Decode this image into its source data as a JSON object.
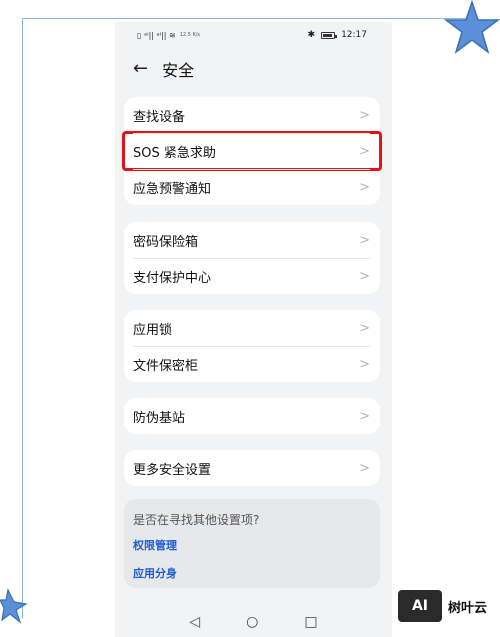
{
  "status_bar": {
    "left_signal": "▯ ᵃᴵ|| ᵃᴵ|| ≋",
    "left_speed": "12.5 K/s",
    "time": "12:17"
  },
  "header": {
    "back_symbol": "←",
    "title": "安全"
  },
  "groups": [
    {
      "items": [
        {
          "label": "查找设备",
          "highlighted": false
        },
        {
          "label": "SOS 紧急求助",
          "highlighted": true
        },
        {
          "label": "应急预警通知",
          "highlighted": false
        }
      ]
    },
    {
      "items": [
        {
          "label": "密码保险箱"
        },
        {
          "label": "支付保护中心"
        }
      ]
    },
    {
      "items": [
        {
          "label": "应用锁"
        },
        {
          "label": "文件保密柜"
        }
      ]
    },
    {
      "items": [
        {
          "label": "防伪基站"
        }
      ]
    },
    {
      "items": [
        {
          "label": "更多安全设置"
        }
      ]
    }
  ],
  "chevron": ">",
  "suggestions": {
    "question": "是否在寻找其他设置项?",
    "links": [
      "权限管理",
      "应用分身"
    ]
  },
  "navbar": {
    "back": "◁",
    "home": "○",
    "recent": "□"
  },
  "watermark": {
    "logo_mark": "AI",
    "logo_text": "树叶云"
  },
  "colors": {
    "highlight_border": "#e2141b",
    "link": "#1a5dd6",
    "background": "#f1f3f5",
    "star": "#5b8fd8"
  }
}
